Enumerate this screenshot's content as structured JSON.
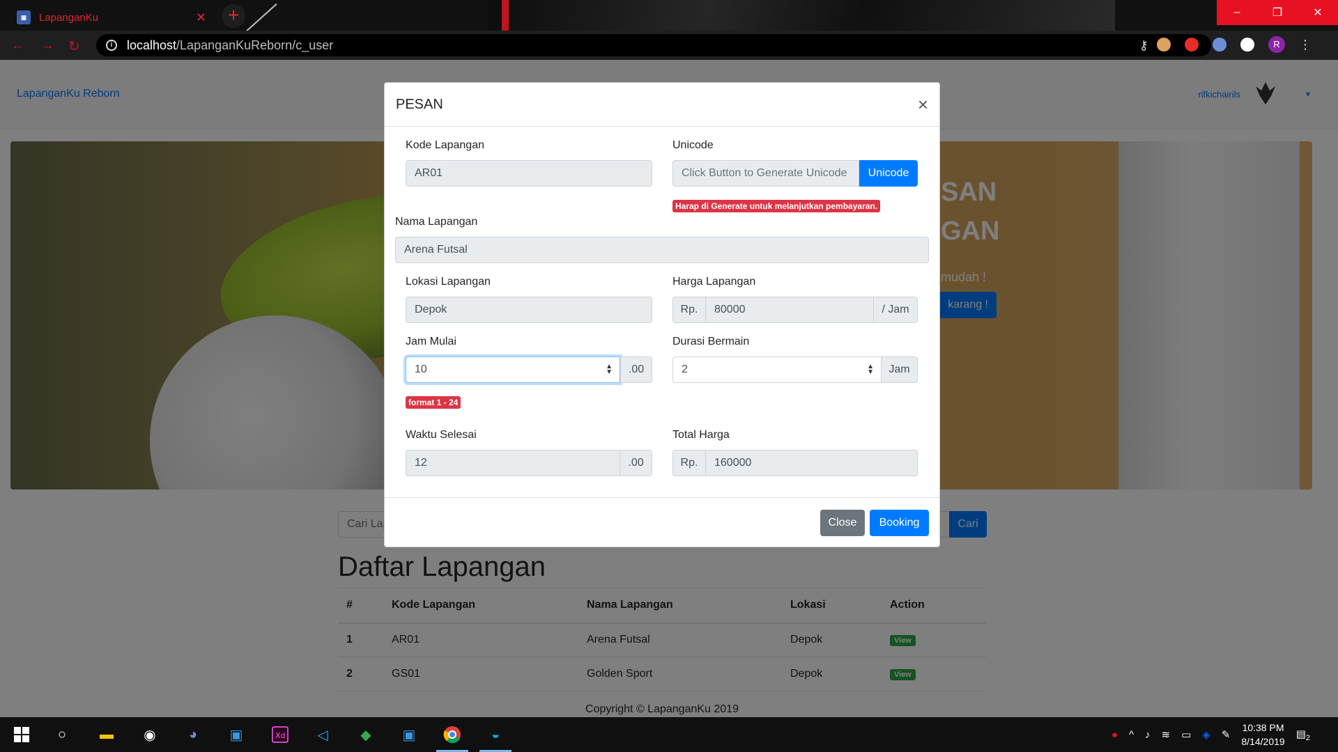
{
  "browser": {
    "tab_title": "LapanganKu",
    "tab_close": "✕",
    "new_tab": "+",
    "url_host": "localhost",
    "url_path": "/LapanganKuReborn/c_user",
    "profile_initial": "R",
    "window_controls": [
      "–",
      "❐",
      "✕"
    ]
  },
  "navbar": {
    "brand": "LapanganKu Reborn",
    "username": "rifkichairils",
    "caret": "▾"
  },
  "hero": {
    "line1": "SAN",
    "line2": "GAN",
    "subtitle": "mudah !",
    "button": "karang !"
  },
  "search": {
    "placeholder": "Cari Lap",
    "button": "Cari"
  },
  "list": {
    "title": "Daftar Lapangan",
    "headers": [
      "#",
      "Kode Lapangan",
      "Nama Lapangan",
      "Lokasi",
      "Action"
    ],
    "rows": [
      {
        "no": "1",
        "kode": "AR01",
        "nama": "Arena Futsal",
        "lokasi": "Depok",
        "action": "View"
      },
      {
        "no": "2",
        "kode": "GS01",
        "nama": "Golden Sport",
        "lokasi": "Depok",
        "action": "View"
      }
    ]
  },
  "footer": {
    "copyright": "Copyright © LapanganKu 2019"
  },
  "modal": {
    "title": "PESAN",
    "close_symbol": "×",
    "kode_label": "Kode Lapangan",
    "kode_value": "AR01",
    "unicode_label": "Unicode",
    "unicode_placeholder": "Click Button to Generate Unicode",
    "unicode_button": "Unicode",
    "unicode_warning": "Harap di Generate untuk melanjutkan pembayaran.",
    "nama_label": "Nama Lapangan",
    "nama_value": "Arena Futsal",
    "lokasi_label": "Lokasi Lapangan",
    "lokasi_value": "Depok",
    "harga_label": "Harga Lapangan",
    "harga_prefix": "Rp.",
    "harga_value": "80000",
    "harga_suffix": "/ Jam",
    "jam_mulai_label": "Jam Mulai",
    "jam_mulai_value": "10",
    "jam_mulai_suffix": ".00",
    "jam_mulai_hint": "format 1 - 24",
    "durasi_label": "Durasi Bermain",
    "durasi_value": "2",
    "durasi_suffix": "Jam",
    "selesai_label": "Waktu Selesai",
    "selesai_value": "12",
    "selesai_suffix": ".00",
    "total_label": "Total Harga",
    "total_prefix": "Rp.",
    "total_value": "160000",
    "close_button": "Close",
    "booking_button": "Booking"
  },
  "taskbar": {
    "time": "10:38 PM",
    "date": "8/14/2019",
    "notification_count": "2"
  },
  "colors": {
    "primary": "#007bff",
    "danger": "#dc3545",
    "secondary": "#6c757d",
    "success": "#28a745",
    "chrome_red": "#e81123"
  }
}
